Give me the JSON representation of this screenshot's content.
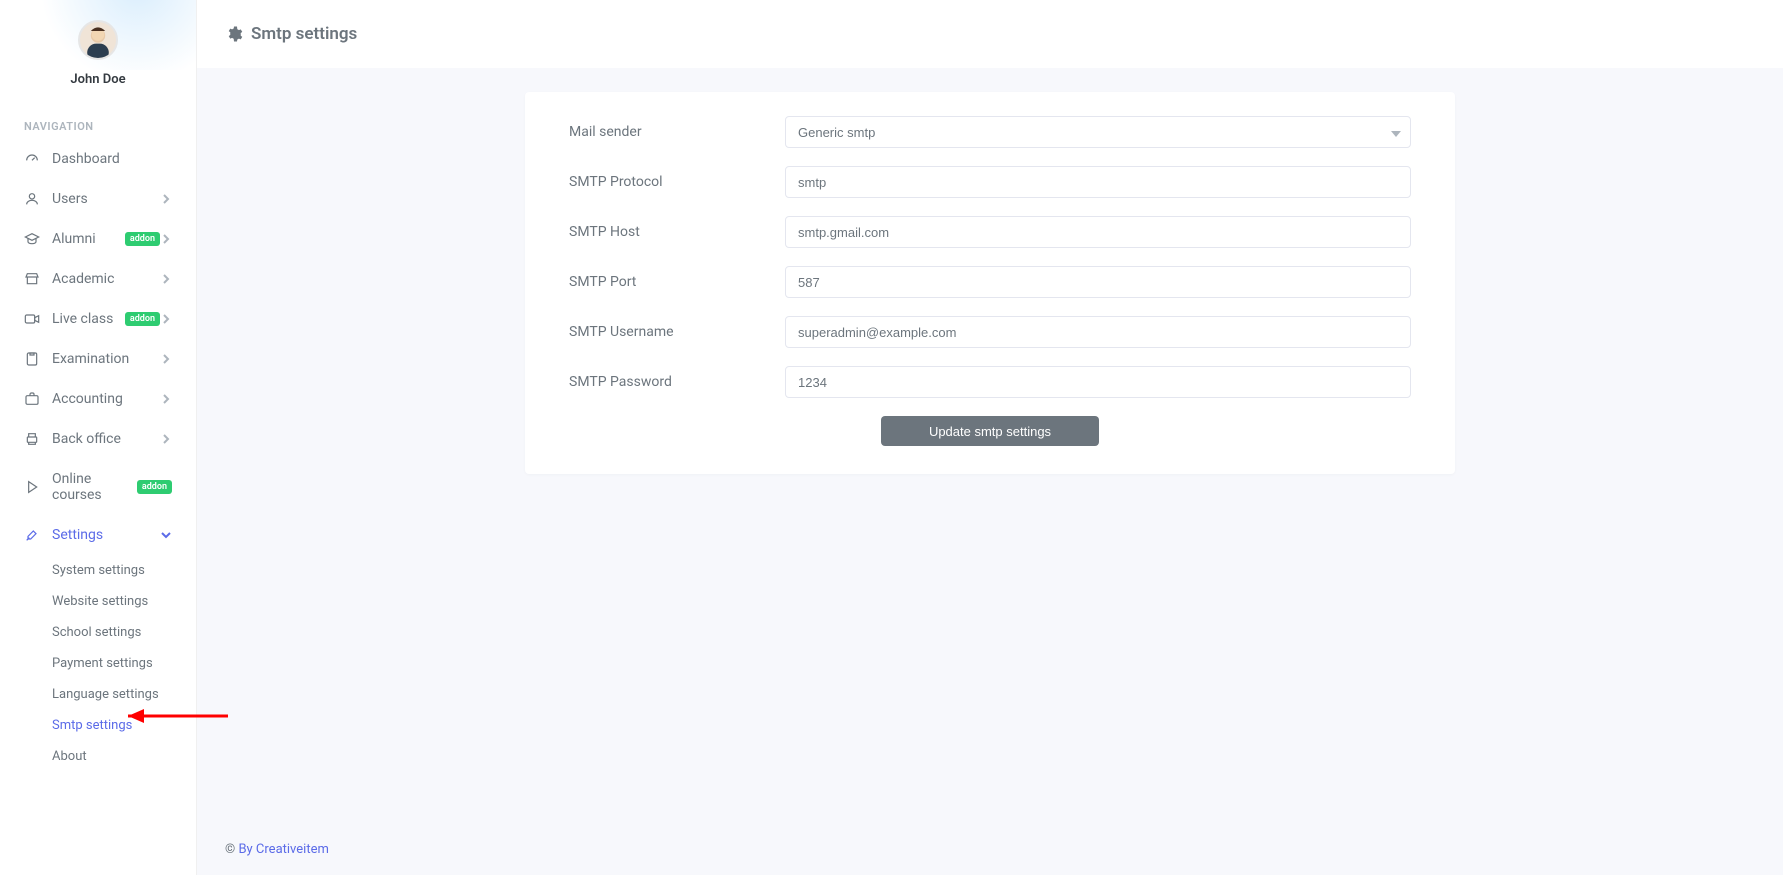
{
  "profile": {
    "name": "John Doe"
  },
  "nav": {
    "heading": "NAVIGATION",
    "items": {
      "dashboard": "Dashboard",
      "users": "Users",
      "alumni": "Alumni",
      "academic": "Academic",
      "live_class": "Live class",
      "examination": "Examination",
      "accounting": "Accounting",
      "back_office": "Back office",
      "online_courses": "Online courses",
      "settings": "Settings"
    },
    "badge_addon": "addon",
    "settings_sub": {
      "system": "System settings",
      "website": "Website settings",
      "school": "School settings",
      "payment": "Payment settings",
      "language": "Language settings",
      "smtp": "Smtp settings",
      "about": "About"
    }
  },
  "page": {
    "title": "Smtp settings"
  },
  "form": {
    "labels": {
      "mail_sender": "Mail sender",
      "protocol": "SMTP Protocol",
      "host": "SMTP Host",
      "port": "SMTP Port",
      "username": "SMTP Username",
      "password": "SMTP Password"
    },
    "values": {
      "mail_sender": "Generic smtp",
      "protocol": "smtp",
      "host": "smtp.gmail.com",
      "port": "587",
      "username": "superadmin@example.com",
      "password": "1234"
    },
    "submit": "Update smtp settings"
  },
  "footer": {
    "copyright": "© ",
    "link": "By Creativeitem"
  }
}
